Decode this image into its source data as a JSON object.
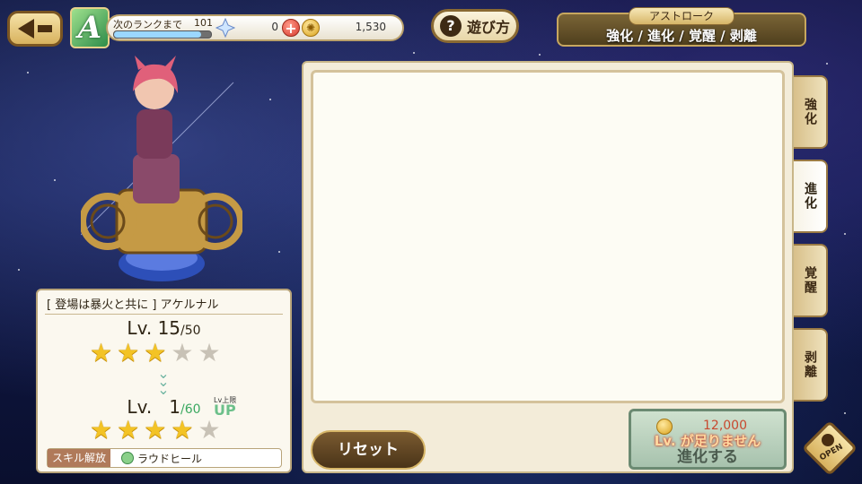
{
  "header": {
    "rank_label": "次のランクまで",
    "rank_remaining": "101",
    "exp_fraction": 0.9,
    "crystal_count": "0",
    "coin_count": "1,530",
    "howto_label": "遊び方",
    "section_tag": "アストローク",
    "section_title": "強化 / 進化 / 覚醒 / 剥離",
    "rank_emblem_letter": "A"
  },
  "character": {
    "name": "[ 登場は暴火と共に ] アケルナル",
    "current": {
      "lv_prefix": "Lv.",
      "level": "15",
      "max": "/50",
      "stars_on": 3,
      "stars_total": 5
    },
    "next": {
      "lv_prefix": "Lv.",
      "level": "1",
      "max": "/60",
      "stars_on": 4,
      "stars_total": 5,
      "badge_top": "Lv上限",
      "badge_up": "UP"
    },
    "skill_tag": "スキル解放",
    "skill_name": "ラウドヒール"
  },
  "actions": {
    "reset_label": "リセット",
    "evolve_cost": "12,000",
    "evolve_label": "進化する",
    "evolve_warning": "Lv. が足りません"
  },
  "tabs": [
    {
      "label": "強化",
      "active": false
    },
    {
      "label": "進化",
      "active": true
    },
    {
      "label": "覚醒",
      "active": false
    },
    {
      "label": "剥離",
      "active": false
    }
  ],
  "open_label": "OPEN",
  "colors": {
    "star_on": "#f3c325",
    "star_off": "#c8c2b6",
    "gold_border": "#c7a75f",
    "warn": "#c8492f"
  }
}
